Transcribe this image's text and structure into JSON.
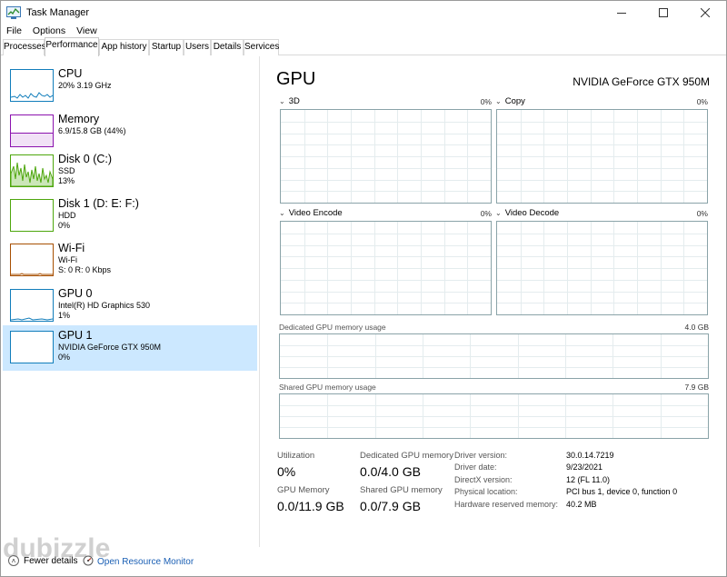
{
  "window": {
    "title": "Task Manager"
  },
  "menu": [
    "File",
    "Options",
    "View"
  ],
  "tabs": [
    {
      "label": "Processes",
      "active": false
    },
    {
      "label": "Performance",
      "active": true
    },
    {
      "label": "App history",
      "active": false
    },
    {
      "label": "Startup",
      "active": false
    },
    {
      "label": "Users",
      "active": false
    },
    {
      "label": "Details",
      "active": false
    },
    {
      "label": "Services",
      "active": false
    }
  ],
  "sidebar": [
    {
      "title": "CPU",
      "lines": [
        "20% 3.19 GHz"
      ],
      "color": "#117dbb",
      "selected": false
    },
    {
      "title": "Memory",
      "lines": [
        "6.9/15.8 GB (44%)"
      ],
      "color": "#8b12ae",
      "selected": false
    },
    {
      "title": "Disk 0 (C:)",
      "lines": [
        "SSD",
        "13%"
      ],
      "color": "#4da60c",
      "selected": false
    },
    {
      "title": "Disk 1 (D: E: F:)",
      "lines": [
        "HDD",
        "0%"
      ],
      "color": "#4da60c",
      "selected": false
    },
    {
      "title": "Wi-Fi",
      "lines": [
        "Wi-Fi",
        "S: 0 R: 0 Kbps"
      ],
      "color": "#a74f01",
      "selected": false
    },
    {
      "title": "GPU 0",
      "lines": [
        "Intel(R) HD Graphics 530",
        "1%"
      ],
      "color": "#117dbb",
      "selected": false
    },
    {
      "title": "GPU 1",
      "lines": [
        "NVIDIA GeForce GTX 950M",
        "0%"
      ],
      "color": "#117dbb",
      "selected": true
    }
  ],
  "main": {
    "title": "GPU",
    "model": "NVIDIA GeForce GTX 950M",
    "engines": [
      {
        "label": "3D",
        "pct": "0%"
      },
      {
        "label": "Copy",
        "pct": "0%"
      },
      {
        "label": "Video Encode",
        "pct": "0%"
      },
      {
        "label": "Video Decode",
        "pct": "0%"
      }
    ],
    "dedicated_label": "Dedicated GPU memory usage",
    "dedicated_max": "4.0 GB",
    "shared_label": "Shared GPU memory usage",
    "shared_max": "7.9 GB",
    "stats": {
      "utilization_label": "Utilization",
      "utilization": "0%",
      "dedicated_mem_label": "Dedicated GPU memory",
      "dedicated_mem": "0.0/4.0 GB",
      "gpu_mem_label": "GPU Memory",
      "gpu_mem": "0.0/11.9 GB",
      "shared_mem_label": "Shared GPU memory",
      "shared_mem": "0.0/7.9 GB"
    },
    "info": [
      {
        "key": "Driver version:",
        "value": "30.0.14.7219"
      },
      {
        "key": "Driver date:",
        "value": "9/23/2021"
      },
      {
        "key": "DirectX version:",
        "value": "12 (FL 11.0)"
      },
      {
        "key": "Physical location:",
        "value": "PCI bus 1, device 0, function 0"
      },
      {
        "key": "Hardware reserved memory:",
        "value": "40.2 MB"
      }
    ]
  },
  "bottom": {
    "fewer_details": "Fewer details",
    "resource_monitor": "Open Resource Monitor"
  },
  "watermark": "dubizzle"
}
